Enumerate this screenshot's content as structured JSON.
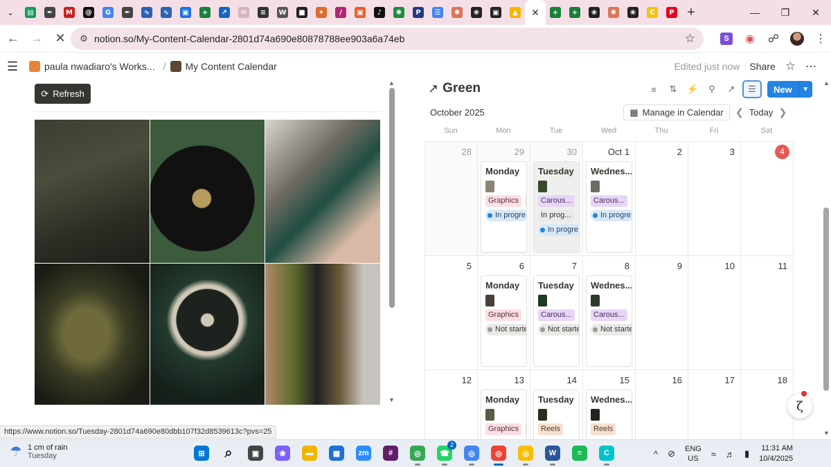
{
  "browser": {
    "tab_icons": [
      {
        "icon": "sheets-icon",
        "color": "#0f9d58",
        "glyph": "▤"
      },
      {
        "icon": "pen-icon",
        "color": "#444444",
        "glyph": "✒"
      },
      {
        "icon": "gmail-icon",
        "color": "#c5221f",
        "glyph": "M"
      },
      {
        "icon": "threads-icon",
        "color": "#111111",
        "glyph": "@"
      },
      {
        "icon": "google-icon",
        "color": "#4285f4",
        "glyph": "G"
      },
      {
        "icon": "pen-icon",
        "color": "#444444",
        "glyph": "✒"
      },
      {
        "icon": "wave-icon",
        "color": "#2b62b8",
        "glyph": "∿"
      },
      {
        "icon": "wave-icon",
        "color": "#2b62b8",
        "glyph": "∿"
      },
      {
        "icon": "forms-icon",
        "color": "#1a73e8",
        "glyph": "▣"
      },
      {
        "icon": "plus-doc-icon",
        "color": "#188038",
        "glyph": "+"
      },
      {
        "icon": "arrow-doc-icon",
        "color": "#1565c0",
        "glyph": "↗"
      },
      {
        "icon": "mail-icon",
        "color": "#d4b4be",
        "glyph": "✉"
      },
      {
        "icon": "clapper-icon",
        "color": "#333333",
        "glyph": "≡"
      },
      {
        "icon": "wikipedia-icon",
        "color": "#555555",
        "glyph": "W"
      },
      {
        "icon": "imdb-icon",
        "color": "#222222",
        "glyph": "■"
      },
      {
        "icon": "game-icon",
        "color": "#e06c2b",
        "glyph": "✦"
      },
      {
        "icon": "feather-icon",
        "color": "#b02672",
        "glyph": "/"
      },
      {
        "icon": "orange-box-icon",
        "color": "#e8622a",
        "glyph": "▣"
      },
      {
        "icon": "tiktok-icon",
        "color": "#111111",
        "glyph": "♪"
      },
      {
        "icon": "green-star-icon",
        "color": "#1e8e3e",
        "glyph": "✱"
      },
      {
        "icon": "paypal-icon",
        "color": "#253b80",
        "glyph": "P"
      },
      {
        "icon": "docs-icon",
        "color": "#4285f4",
        "glyph": "☰"
      },
      {
        "icon": "claude-icon",
        "color": "#d97757",
        "glyph": "✱"
      },
      {
        "icon": "chatgpt-icon",
        "color": "#222222",
        "glyph": "❀"
      },
      {
        "icon": "notion-icon",
        "color": "#222222",
        "glyph": "▣"
      },
      {
        "icon": "drive-icon",
        "color": "#f6b500",
        "glyph": "▲"
      }
    ],
    "active_tab_close": "✕",
    "tab_icons_after": [
      {
        "icon": "plus-doc-icon",
        "color": "#188038",
        "glyph": "+"
      },
      {
        "icon": "plus-doc-icon",
        "color": "#188038",
        "glyph": "+"
      },
      {
        "icon": "chatgpt-icon",
        "color": "#222222",
        "glyph": "❀"
      },
      {
        "icon": "claude-icon",
        "color": "#d97757",
        "glyph": "✱"
      },
      {
        "icon": "chatgpt-icon",
        "color": "#222222",
        "glyph": "❀"
      },
      {
        "icon": "yellow-c-icon",
        "color": "#f1c40f",
        "glyph": "C"
      },
      {
        "icon": "pinterest-icon",
        "color": "#e60023",
        "glyph": "P"
      }
    ],
    "url": "notion.so/My-Content-Calendar-2801d74a690e80878788ee903a6a74eb"
  },
  "notion": {
    "breadcrumb_workspace": "paula nwadiaro's Works...",
    "breadcrumb_page": "My Content Calendar",
    "edited": "Edited just now",
    "share": "Share"
  },
  "gallery": {
    "refresh_label": "Refresh",
    "photos": [
      {
        "name": "green-sofa-photo",
        "bg": "linear-gradient(160deg,#3b3e31 0%,#4a4d3c 35%,#2c2e25 70%,#1c1d18 100%)"
      },
      {
        "name": "vinyl-turntable-photo",
        "bg": "radial-gradient(circle at 45% 55%,#b89b5e 0 9%,#111 10% 52%,#3c5a3c 53%)"
      },
      {
        "name": "green-phone-case-photo",
        "bg": "linear-gradient(135deg,#d9d6d0 0%,#6f6a62 35%,#1e4e42 55%,#d8b9a6 80%)"
      },
      {
        "name": "green-handbag-photo",
        "bg": "radial-gradient(ellipse at 45% 50%,#6e6a3b 0 25%,#3a3c24 45%,#1a1b14 80%)"
      },
      {
        "name": "car-interior-photo",
        "bg": "radial-gradient(circle at 50% 40%,#cfc8b5 0 6%,#1e221e 7% 30%,#cfc8b5 31% 34%,#243a2f 40%,#142019 80%)"
      },
      {
        "name": "bangles-photo",
        "bg": "linear-gradient(90deg,#b08a6a 0%,#5d6a2c 25%,#222 45%,#6b5a3a 65%,#c6c3bd 85%)"
      }
    ]
  },
  "calendar": {
    "title": "Green",
    "month": "October 2025",
    "manage_label": "Manage in Calendar",
    "today_label": "Today",
    "new_label": "New",
    "weekdays": [
      "Sun",
      "Mon",
      "Tue",
      "Wed",
      "Thu",
      "Fri",
      "Sat"
    ],
    "weeks": [
      [
        {
          "day": "28",
          "past": true
        },
        {
          "day": "29",
          "past": true,
          "card": {
            "title": "Monday",
            "thumb": "#8c8472",
            "tag": "Graphics",
            "tag_style": "graphics",
            "more_tag": true,
            "status": "In progre",
            "status_style": "prog"
          }
        },
        {
          "day": "30",
          "past": true,
          "card": {
            "title": "Tuesday",
            "thumb": "#3a4a2e",
            "tag": "Carous...",
            "tag_style": "carousel",
            "plain": "In prog...",
            "status": "In progre",
            "status_style": "prog",
            "highlight": true
          }
        },
        {
          "day": "Oct 1",
          "card": {
            "title": "Wednes...",
            "thumb": "#6c6f66",
            "tag": "Carous...",
            "tag_style": "carousel",
            "status": "In progre",
            "status_style": "prog"
          }
        },
        {
          "day": "2"
        },
        {
          "day": "3"
        },
        {
          "day": "4",
          "today": true
        }
      ],
      [
        {
          "day": "5"
        },
        {
          "day": "6",
          "card": {
            "title": "Monday",
            "thumb": "#4a3f36",
            "tag": "Graphics",
            "tag_style": "graphics",
            "status": "Not starte",
            "status_style": "not"
          }
        },
        {
          "day": "7",
          "card": {
            "title": "Tuesday",
            "thumb": "#1f3a22",
            "tag": "Carous...",
            "tag_style": "carousel",
            "status": "Not starte",
            "status_style": "not"
          }
        },
        {
          "day": "8",
          "card": {
            "title": "Wednes...",
            "thumb": "#2f3a2a",
            "tag": "Carous...",
            "tag_style": "carousel",
            "status": "Not starte",
            "status_style": "not"
          }
        },
        {
          "day": "9"
        },
        {
          "day": "10"
        },
        {
          "day": "11"
        }
      ],
      [
        {
          "day": "12"
        },
        {
          "day": "13",
          "card": {
            "title": "Monday",
            "thumb": "#5b5a45",
            "tag": "Graphics",
            "tag_style": "graphics",
            "more_tag": true
          }
        },
        {
          "day": "14",
          "card": {
            "title": "Tuesday",
            "thumb": "#26301f",
            "tag": "Reels",
            "tag_style": "reels"
          }
        },
        {
          "day": "15",
          "card": {
            "title": "Wednes...",
            "thumb": "#1f241c",
            "tag": "Reels",
            "tag_style": "reels"
          }
        },
        {
          "day": "16"
        },
        {
          "day": "17"
        },
        {
          "day": "18"
        }
      ]
    ],
    "colors": {
      "in_progress_dot": "#2383e2",
      "not_started_dot": "#9b9a97",
      "today": "#eb5757",
      "accent": "#2383e2"
    }
  },
  "status_url": "https://www.notion.so/Tuesday-2801d74a690e80dbb107f32d8539613c?pvs=25",
  "taskbar": {
    "weather_line1": "1 cm of rain",
    "weather_line2": "Tuesday",
    "apps": [
      {
        "icon": "windows-start-icon",
        "color": "#0078d4",
        "glyph": "⊞"
      },
      {
        "icon": "search-icon",
        "color": "#e9eef4",
        "glyph": "⌕"
      },
      {
        "icon": "task-view-icon",
        "color": "#444444",
        "glyph": "▣"
      },
      {
        "icon": "copilot-icon",
        "color": "#7b61ff",
        "glyph": "❀"
      },
      {
        "icon": "file-explorer-icon",
        "color": "#f2b400",
        "glyph": "▬"
      },
      {
        "icon": "store-icon",
        "color": "#1f6fd6",
        "glyph": "▦"
      },
      {
        "icon": "zoom-icon",
        "color": "#2d8cff",
        "glyph": "zm"
      },
      {
        "icon": "slack-icon",
        "color": "#611f69",
        "glyph": "#"
      },
      {
        "icon": "chrome-icon",
        "color": "#34a853",
        "glyph": "◎",
        "state": "run"
      },
      {
        "icon": "whatsapp-icon",
        "color": "#25d366",
        "glyph": "☎",
        "badge": "2",
        "state": "run"
      },
      {
        "icon": "chrome-icon",
        "color": "#4285f4",
        "glyph": "◎",
        "state": "run"
      },
      {
        "icon": "chrome-profile-icon",
        "color": "#ea4335",
        "glyph": "◎",
        "state": "act"
      },
      {
        "icon": "chrome-icon",
        "color": "#fbbc05",
        "glyph": "◎",
        "state": "run"
      },
      {
        "icon": "word-icon",
        "color": "#2b579a",
        "glyph": "W",
        "state": "run"
      },
      {
        "icon": "spotify-icon",
        "color": "#1db954",
        "glyph": "≡"
      },
      {
        "icon": "canva-icon",
        "color": "#00c4cc",
        "glyph": "C",
        "state": "run"
      }
    ],
    "lang_1": "ENG",
    "lang_2": "US",
    "time": "11:31 AM",
    "date": "10/4/2025"
  }
}
